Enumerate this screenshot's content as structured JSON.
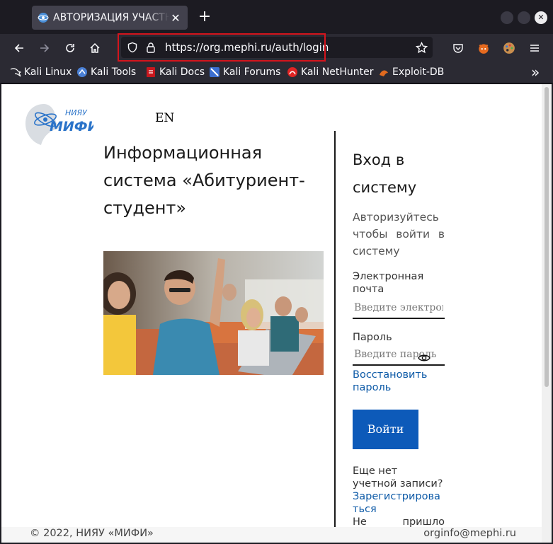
{
  "browser": {
    "tab_title": "АВТОРИЗАЦИЯ УЧАСТНИКА",
    "tab_close": "✕",
    "new_tab": "+",
    "url": "https://org.mephi.ru/auth/login",
    "bookmarks": [
      {
        "label": "Kali Linux",
        "color": "#ffffff"
      },
      {
        "label": "Kali Tools",
        "color": "#4a7fd4"
      },
      {
        "label": "Kali Docs",
        "color": "#c8171e"
      },
      {
        "label": "Kali Forums",
        "color": "#3c6fd1"
      },
      {
        "label": "Kali NetHunter",
        "color": "#e02424"
      },
      {
        "label": "Exploit-DB",
        "color": "#e06a1f"
      }
    ],
    "overflow": "»"
  },
  "page": {
    "lang_switch": "EN",
    "title": "Информационная система «Абитуриент-студент»",
    "login": {
      "heading": "Вход в систему",
      "subtitle": "Авторизуйтесь чтобы войти в систему",
      "email_label": "Электронная почта",
      "email_placeholder": "Введите электронную почту",
      "password_label": "Пароль",
      "password_placeholder": "Введите пароль",
      "restore_link": "Восстановить пароль",
      "submit": "Войти",
      "no_account": "Еще нет учетной записи?",
      "register_link": "Зарегистрироваться",
      "not_received_1": "Не",
      "not_received_2": "пришло"
    },
    "footer": {
      "copyright": "© 2022, НИЯУ «МИФИ»",
      "email": "orginfo@mephi.ru"
    }
  },
  "colors": {
    "accent": "#0d5ab9",
    "link": "#0d5aa7",
    "highlight": "#d4141c"
  }
}
